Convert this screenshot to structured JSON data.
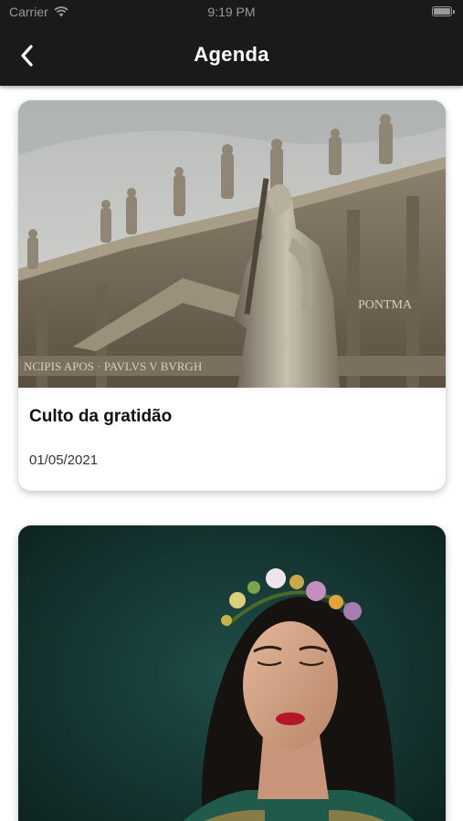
{
  "status_bar": {
    "carrier": "Carrier",
    "time": "9:19 PM",
    "icons": [
      "wifi-icon",
      "battery-icon"
    ]
  },
  "nav": {
    "title": "Agenda",
    "back_icon": "chevron-left-icon"
  },
  "events": [
    {
      "title": "Culto da gratidão",
      "date": "01/05/2021",
      "image_inscription": "PAVLVS V BVRGH · PONTMA · NCIPIS APOS"
    },
    {
      "title": "",
      "date": ""
    }
  ],
  "colors": {
    "nav_background": "#1a1a1a",
    "nav_text": "#ffffff",
    "card_background": "#ffffff",
    "text_primary": "#111111",
    "text_secondary": "#333333"
  }
}
